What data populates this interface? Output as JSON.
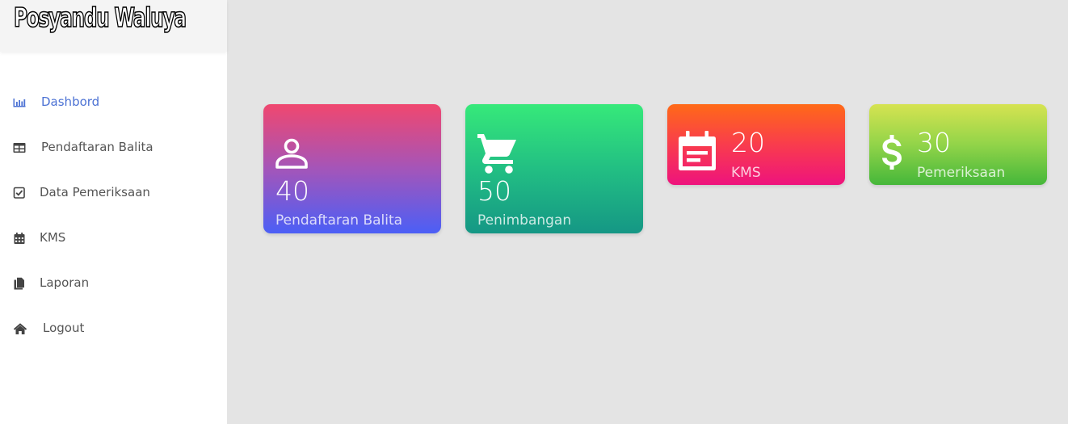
{
  "brand": {
    "title": "Posyandu Waluya"
  },
  "sidebar": {
    "items": [
      {
        "label": "Dashbord",
        "icon": "bar-chart-icon",
        "active": true
      },
      {
        "label": "Pendaftaran Balita",
        "icon": "table-icon"
      },
      {
        "label": "Data Pemeriksaan",
        "icon": "check-square-icon"
      },
      {
        "label": "KMS",
        "icon": "calendar-icon"
      },
      {
        "label": "Laporan",
        "icon": "files-icon"
      },
      {
        "label": "Logout",
        "icon": "home-icon"
      }
    ]
  },
  "cards": [
    {
      "value": "40",
      "label": "Pendaftaran Balita",
      "icon": "person-icon"
    },
    {
      "value": "50",
      "label": "Penimbangan",
      "icon": "cart-icon"
    },
    {
      "value": "20",
      "label": "KMS",
      "icon": "event-note-icon"
    },
    {
      "value": "30",
      "label": "Pemeriksaan",
      "icon": "dollar-icon"
    }
  ],
  "colors": {
    "accent": "#4c72d4",
    "sidebar_bg": "#ffffff",
    "content_bg": "#e4e4e4",
    "card_pink_to_blue": [
      "#f0476f",
      "#4b5ff6"
    ],
    "card_green_to_teal": [
      "#36e97a",
      "#159785"
    ],
    "card_orange_to_magenta": [
      "#ff6a17",
      "#ee137d"
    ],
    "card_lime_to_green": [
      "#d6e351",
      "#45b73a"
    ]
  }
}
